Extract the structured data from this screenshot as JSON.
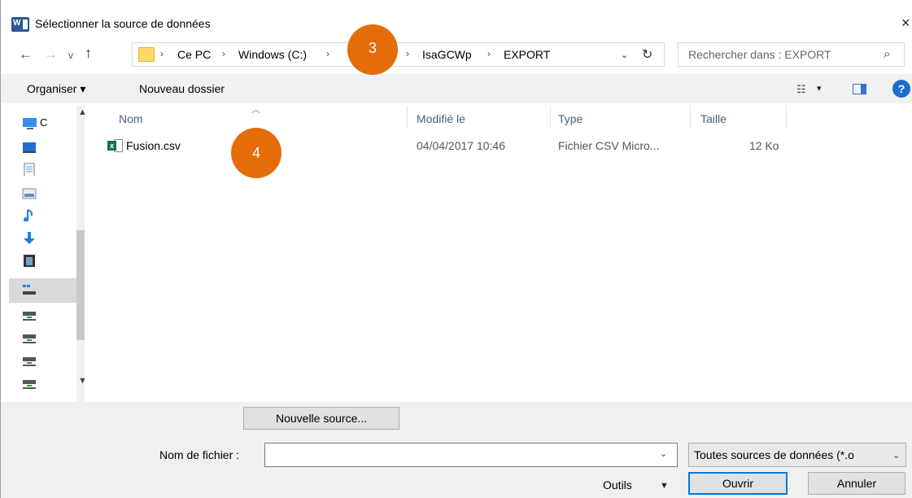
{
  "window": {
    "title": "Sélectionner la source de données",
    "close_glyph": "×"
  },
  "nav": {
    "back": "←",
    "forward": "→",
    "recent": "v",
    "up": "↑"
  },
  "address": {
    "crumbs": [
      "Ce PC",
      "Windows (C:)",
      "IsaGCWp",
      "EXPORT"
    ],
    "separator": "›",
    "refresh": "↻",
    "dropdown": "⌄"
  },
  "search": {
    "placeholder": "Rechercher dans : EXPORT"
  },
  "badges": {
    "step3": "3",
    "step4": "4"
  },
  "toolbar": {
    "organize": "Organiser ▾",
    "new_folder": "Nouveau dossier",
    "help": "?"
  },
  "columns": {
    "name": "Nom",
    "modified": "Modifié le",
    "type": "Type",
    "size": "Taille"
  },
  "files": [
    {
      "name": "Fusion.csv",
      "modified": "04/04/2017 10:46",
      "type": "Fichier CSV Micro...",
      "size": "12 Ko"
    }
  ],
  "nav_pane": {
    "first_label": "C"
  },
  "footer": {
    "new_source": "Nouvelle source...",
    "filename_label": "Nom de fichier :",
    "filename_value": "",
    "filter": "Toutes sources de données (*.o",
    "tools": "Outils",
    "open": "Ouvrir",
    "cancel": "Annuler"
  },
  "colors": {
    "badge": "#e46d0a",
    "accent": "#0078d7",
    "excel_green": "#1d7245"
  }
}
